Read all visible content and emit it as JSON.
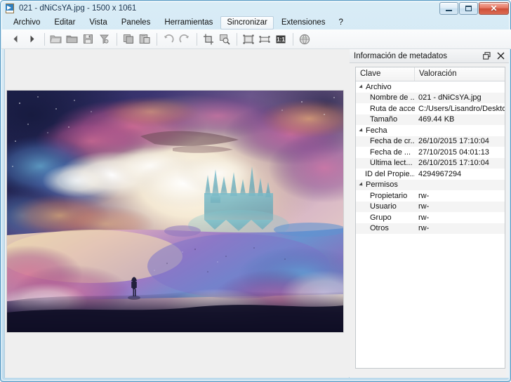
{
  "window": {
    "title": "021 - dNiCsYA.jpg  - 1500 x 1061",
    "app_icon": "image-file-icon",
    "minimize_label": "–",
    "maximize_label": "□",
    "close_label": "✕"
  },
  "menubar": {
    "items": [
      {
        "label": "Archivo",
        "name": "menu-archivo",
        "active": false
      },
      {
        "label": "Editar",
        "name": "menu-editar",
        "active": false
      },
      {
        "label": "Vista",
        "name": "menu-vista",
        "active": false
      },
      {
        "label": "Paneles",
        "name": "menu-paneles",
        "active": false
      },
      {
        "label": "Herramientas",
        "name": "menu-herramientas",
        "active": false
      },
      {
        "label": "Sincronizar",
        "name": "menu-sincronizar",
        "active": true
      },
      {
        "label": "Extensiones",
        "name": "menu-extensiones",
        "active": false
      },
      {
        "label": "?",
        "name": "menu-ayuda",
        "active": false
      }
    ]
  },
  "toolbar": {
    "buttons": [
      {
        "icon": "previous-arrow-icon",
        "group": 0
      },
      {
        "icon": "next-arrow-icon",
        "group": 0
      },
      {
        "icon": "open-folder-icon",
        "group": 1
      },
      {
        "icon": "folder-icon",
        "group": 1
      },
      {
        "icon": "save-icon",
        "group": 1
      },
      {
        "icon": "filter-icon",
        "group": 1
      },
      {
        "icon": "copy-icon",
        "group": 2
      },
      {
        "icon": "paste-icon",
        "group": 2
      },
      {
        "icon": "undo-icon",
        "group": 3
      },
      {
        "icon": "redo-icon",
        "group": 3
      },
      {
        "icon": "crop-icon",
        "group": 4
      },
      {
        "icon": "zoom-select-icon",
        "group": 4
      },
      {
        "icon": "fit-window-icon",
        "group": 5
      },
      {
        "icon": "fit-width-icon",
        "group": 5
      },
      {
        "icon": "zoom-actual-size-icon",
        "group": 5
      },
      {
        "icon": "globe-icon",
        "group": 6
      }
    ]
  },
  "metadata_panel": {
    "title": "Información de metadatos",
    "float_button": "restore-icon",
    "close_button": "close-icon",
    "columns": {
      "key": "Clave",
      "value": "Valoración"
    },
    "rows": [
      {
        "level": "group",
        "key": "Archivo",
        "value": ""
      },
      {
        "level": "leaf",
        "key": "Nombre de ...",
        "value": "021 - dNiCsYA.jpg"
      },
      {
        "level": "leaf",
        "key": "Ruta de acce...",
        "value": "C:/Users/Lisandro/Deskto..."
      },
      {
        "level": "leaf",
        "key": "Tamaño",
        "value": "469.44 KB"
      },
      {
        "level": "group",
        "key": "Fecha",
        "value": ""
      },
      {
        "level": "leaf",
        "key": "Fecha de cr...",
        "value": "26/10/2015 17:10:04"
      },
      {
        "level": "leaf",
        "key": "Fecha de ...",
        "value": "27/10/2015 04:01:13"
      },
      {
        "level": "leaf",
        "key": "Última lect...",
        "value": "26/10/2015 17:10:04"
      },
      {
        "level": "leafA",
        "key": "ID del Propie...",
        "value": "4294967294"
      },
      {
        "level": "group",
        "key": "Permisos",
        "value": ""
      },
      {
        "level": "leaf",
        "key": "Propietario",
        "value": "rw-"
      },
      {
        "level": "leaf",
        "key": "Usuario",
        "value": "rw-"
      },
      {
        "level": "leaf",
        "key": "Grupo",
        "value": "rw-"
      },
      {
        "level": "leaf",
        "key": "Otros",
        "value": "rw-"
      }
    ]
  },
  "viewer": {
    "image_name": "fantasy-castle-clouds-artwork",
    "image_dimensions": "1500 x 1061"
  },
  "colors": {
    "frame": "#5b9bc4",
    "titlebar_text": "#11304d",
    "accent_close": "#cd4e38",
    "panel_bg": "#f0f0f0",
    "row_alt": "#f4f4f4"
  }
}
